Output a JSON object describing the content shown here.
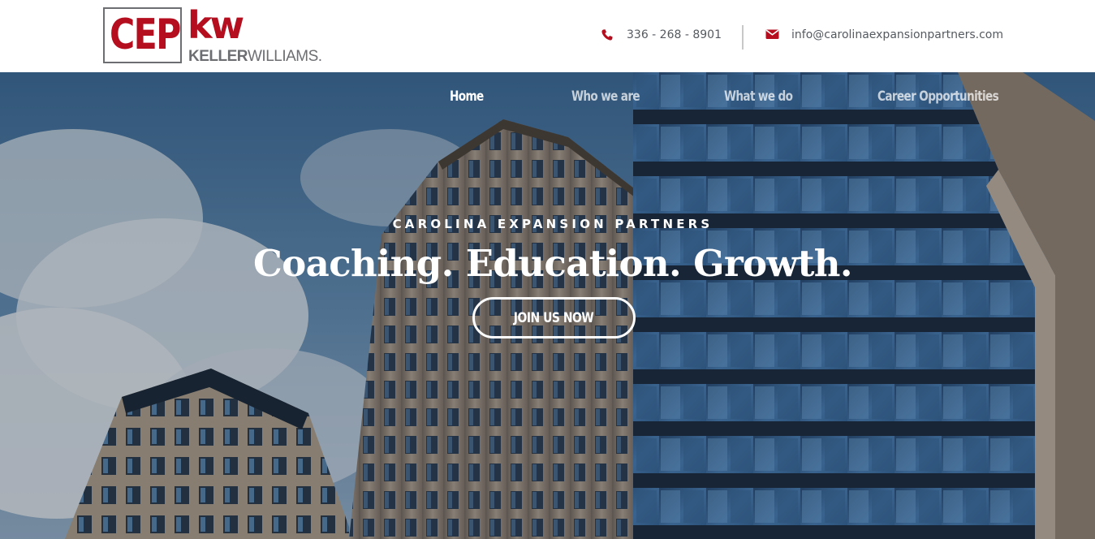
{
  "header": {
    "logo": {
      "cep_text": "CEP",
      "kw_text": "kw",
      "brand_first": "KELLER",
      "brand_second": "WILLIAMS."
    },
    "contact": {
      "phone": "336 - 268 - 8901",
      "email": "info@carolinaexpansionpartners.com",
      "phone_icon": "phone-icon",
      "email_icon": "envelope-icon"
    }
  },
  "nav": {
    "items": [
      {
        "label": "Home",
        "active": true
      },
      {
        "label": "Who we are",
        "active": false
      },
      {
        "label": "What we do",
        "active": false
      },
      {
        "label": "Career Opportunities",
        "active": false
      }
    ]
  },
  "hero": {
    "eyebrow": "CAROLINA EXPANSION PARTNERS",
    "headline": "Coaching. Education. Growth.",
    "cta_label": "JOIN US NOW"
  },
  "colors": {
    "brand_red": "#b40e1f",
    "logo_gray": "#6d6e71",
    "contact_text": "#555a60",
    "hero_text": "#ffffff"
  }
}
